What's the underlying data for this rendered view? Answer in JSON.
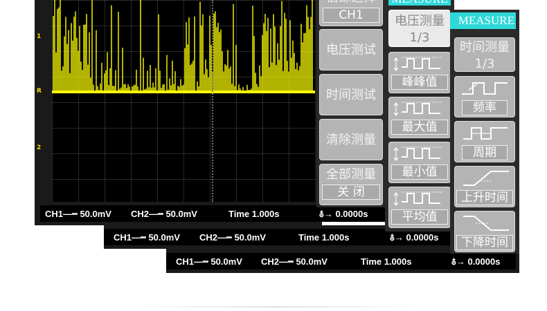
{
  "status_bars": [
    {
      "ch1": "CH1—┉ 50.0mV",
      "ch2": "CH2—┉ 50.0mV",
      "time": "Time  1.000s",
      "trig": "0.0000s"
    },
    {
      "ch1": "CH1—┉ 50.0mV",
      "ch2": "CH2—┉ 50.0mV",
      "time": "Time  1.000s",
      "trig": "0.0000s"
    },
    {
      "ch1": "CH1—┉ 50.0mV",
      "ch2": "CH2—┉ 50.0mV",
      "time": "Time  1.000s",
      "trig": "0.0000s"
    }
  ],
  "channel_markers": {
    "ch1": "1",
    "ref": "R",
    "ch2": "2"
  },
  "menu_main": {
    "top_label": "信源选择",
    "source_value": "CH1",
    "voltage_test": "电压测试",
    "time_test": "时间测试",
    "clear": "清除测量",
    "all_measure": "全部测量",
    "all_state": "关  闭"
  },
  "menu_voltage": {
    "header": "MEASURE",
    "title": "电压测量",
    "page": "1/3",
    "items": [
      "峰峰值",
      "最大值",
      "最小值",
      "平均值"
    ]
  },
  "menu_time": {
    "header": "MEASURE",
    "title": "时间测量",
    "page": "1/3",
    "items": [
      "频率",
      "周期",
      "上升时间",
      "下降时间"
    ]
  },
  "colors": {
    "trace": "#ffff00",
    "header": "#2fd8d8",
    "button": "#b4b4b4",
    "background": "#000000"
  }
}
